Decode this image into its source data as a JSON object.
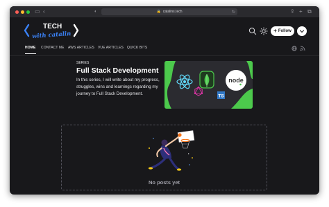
{
  "browser": {
    "url": "catalins.tech"
  },
  "header": {
    "logo_text_top": "TECH",
    "logo_text_bottom": "with catalin",
    "follow_label": "Follow"
  },
  "nav": {
    "items": [
      {
        "label": "HOME",
        "active": true
      },
      {
        "label": "CONTACT ME",
        "active": false
      },
      {
        "label": "AWS ARTICLES",
        "active": false
      },
      {
        "label": "VUE ARTICLES",
        "active": false
      },
      {
        "label": "QUICK BITS",
        "active": false
      }
    ]
  },
  "series": {
    "label": "SERIES",
    "title": "Full Stack Development",
    "description": "In this series, I will write about my progress, struggles, wins and learnings regarding my journey to Full Stack Development."
  },
  "cover": {
    "ts_badge": "TS",
    "node_text": "node"
  },
  "posts": {
    "empty_message": "No posts yet"
  },
  "colors": {
    "background": "#18181b",
    "cover_green": "#4cc94c",
    "logo_blue": "#3b82f6",
    "ts_blue": "#3178c6",
    "react_blue": "#61dafb"
  }
}
